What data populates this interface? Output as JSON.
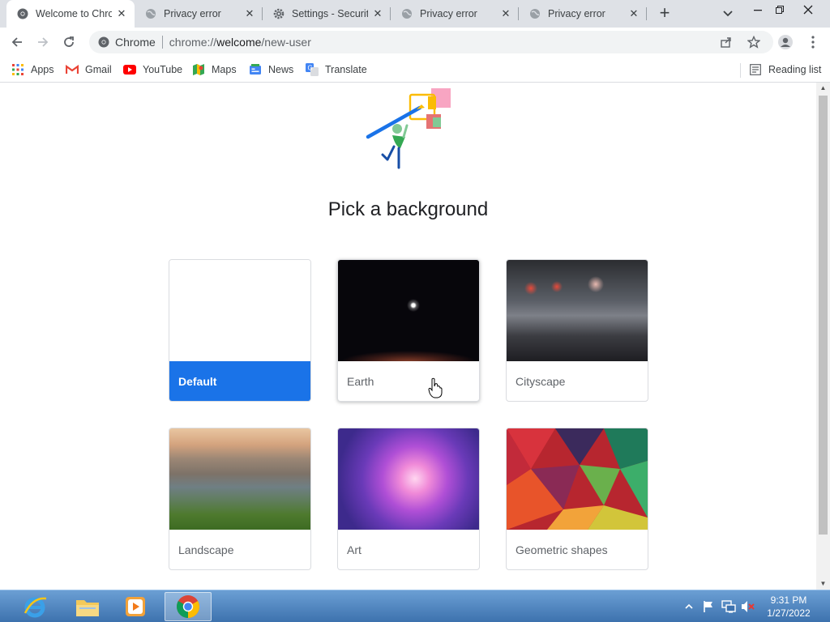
{
  "tabs": [
    {
      "title": "Welcome to Chrome",
      "icon": "chrome-icon",
      "active": true
    },
    {
      "title": "Privacy error",
      "icon": "globe-icon",
      "active": false
    },
    {
      "title": "Settings - Security",
      "icon": "gear-icon",
      "active": false
    },
    {
      "title": "Privacy error",
      "icon": "globe-icon",
      "active": false
    },
    {
      "title": "Privacy error",
      "icon": "globe-icon",
      "active": false
    }
  ],
  "omnibox": {
    "chip": "Chrome",
    "url_host": "chrome://",
    "url_bold": "welcome",
    "url_path": "/new-user"
  },
  "bookmarks": [
    {
      "label": "Apps",
      "icon": "apps-grid-icon"
    },
    {
      "label": "Gmail",
      "icon": "gmail-icon"
    },
    {
      "label": "YouTube",
      "icon": "youtube-icon"
    },
    {
      "label": "Maps",
      "icon": "maps-icon"
    },
    {
      "label": "News",
      "icon": "news-icon"
    },
    {
      "label": "Translate",
      "icon": "translate-icon"
    }
  ],
  "reading_list": "Reading list",
  "page": {
    "heading": "Pick a background",
    "backgrounds": [
      {
        "label": "Default",
        "selected": true
      },
      {
        "label": "Earth",
        "selected": false
      },
      {
        "label": "Cityscape",
        "selected": false
      },
      {
        "label": "Landscape",
        "selected": false
      },
      {
        "label": "Art",
        "selected": false
      },
      {
        "label": "Geometric shapes",
        "selected": false
      }
    ]
  },
  "taskbar": {
    "time": "9:31 PM",
    "date": "1/27/2022"
  },
  "colors": {
    "accent": "#1a73e8",
    "tabstrip": "#dee1e6",
    "taskbar": "#4a80bb"
  }
}
